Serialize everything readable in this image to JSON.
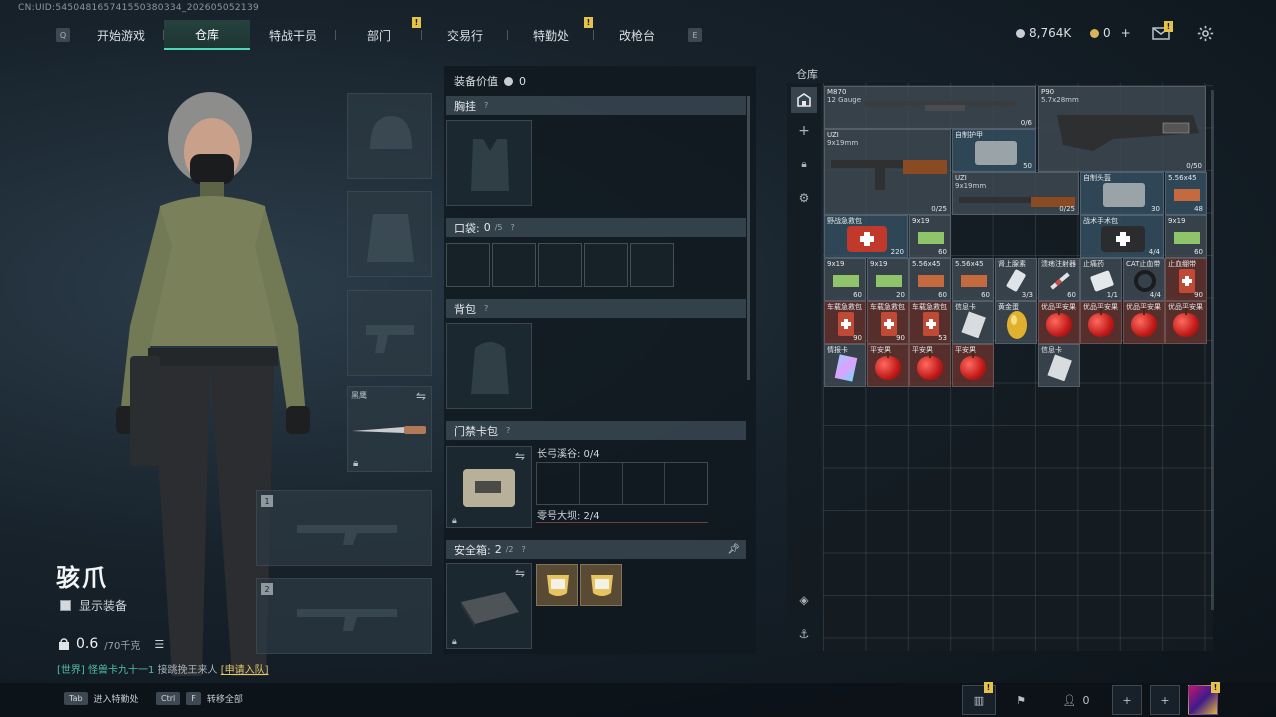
{
  "uid": "CN:UID:545048165741550380334_202605052139",
  "nav": {
    "left_key": "Q",
    "right_key": "E",
    "tabs": [
      {
        "label": "开始游戏",
        "active": false,
        "badge": ""
      },
      {
        "label": "仓库",
        "active": true,
        "badge": ""
      },
      {
        "label": "特战干员",
        "active": false,
        "badge": ""
      },
      {
        "label": "部门",
        "active": false,
        "badge": "!"
      },
      {
        "label": "交易行",
        "active": false,
        "badge": ""
      },
      {
        "label": "特勤处",
        "active": false,
        "badge": "!"
      },
      {
        "label": "改枪台",
        "active": false,
        "badge": ""
      }
    ]
  },
  "currency": {
    "silver": "8,764K",
    "gold": "0",
    "plus": "+",
    "mail_badge": "!"
  },
  "character": {
    "name": "骇爪",
    "show_equipment": "显示装备",
    "weight_value": "0.6",
    "weight_max": "/70千克"
  },
  "chat": {
    "channel": "[世界]",
    "sender": "怪兽卡九十一1",
    "message": "接跳挽王来人",
    "link": "[申请入队]"
  },
  "equipment": {
    "melee_label": "黑鹰",
    "weapon_slot_1": "1",
    "weapon_slot_2": "2"
  },
  "loadout": {
    "value_label": "装备价值",
    "value": "0",
    "chest_rig": "胸挂",
    "pocket_label": "口袋:",
    "pocket_value": "0",
    "pocket_max": "/5",
    "backpack": "背包",
    "keycard": "门禁卡包",
    "keycard_1": "长弓溪谷: 0/4",
    "keycard_2": "零号大坝: 2/4",
    "safe_box_label": "安全箱:",
    "safe_box_value": "2",
    "safe_box_max": "/2",
    "help": "?"
  },
  "warehouse": {
    "title": "仓库",
    "items": [
      {
        "name": "M870",
        "sub": "12 Gauge",
        "count": "0/6"
      },
      {
        "name": "P90",
        "sub": "5.7x28mm",
        "count": "0/50"
      },
      {
        "name": "UZI",
        "sub": "9x19mm",
        "count": "0/25"
      },
      {
        "name": "自制护甲",
        "sub": "",
        "count": "50"
      },
      {
        "name": "UZI",
        "sub": "9x19mm",
        "count": "0/25"
      },
      {
        "name": "自制头盔",
        "sub": "",
        "count": "30"
      },
      {
        "name": "5.56x45",
        "sub": "",
        "count": "48"
      },
      {
        "name": "野战急救包",
        "sub": "",
        "count": "220"
      },
      {
        "name": "9x19",
        "sub": "",
        "count": "60"
      },
      {
        "name": "战术手术包",
        "sub": "",
        "count": "4/4"
      },
      {
        "name": "9x19",
        "sub": "",
        "count": "60"
      },
      {
        "name": "9x19",
        "sub": "",
        "count": "60"
      },
      {
        "name": "9x19",
        "sub": "",
        "count": "20"
      },
      {
        "name": "5.56x45",
        "sub": "",
        "count": "60"
      },
      {
        "name": "5.56x45",
        "sub": "",
        "count": "60"
      },
      {
        "name": "肾上腺素",
        "sub": "",
        "count": "3/3"
      },
      {
        "name": "溃疡注射器",
        "sub": "",
        "count": "60"
      },
      {
        "name": "止痛药",
        "sub": "",
        "count": "1/1"
      },
      {
        "name": "CAT止血带",
        "sub": "",
        "count": "4/4"
      },
      {
        "name": "止血绷带",
        "sub": "",
        "count": "90"
      },
      {
        "name": "车载急救包",
        "sub": "",
        "count": "90"
      },
      {
        "name": "车载急救包",
        "sub": "",
        "count": "90"
      },
      {
        "name": "车载急救包",
        "sub": "",
        "count": "53"
      },
      {
        "name": "信息卡",
        "sub": "",
        "count": ""
      },
      {
        "name": "黄金蛋",
        "sub": "",
        "count": ""
      },
      {
        "name": "优品平安果",
        "sub": "",
        "count": ""
      },
      {
        "name": "优品平安果",
        "sub": "",
        "count": ""
      },
      {
        "name": "优品平安果",
        "sub": "",
        "count": ""
      },
      {
        "name": "优品平安果",
        "sub": "",
        "count": ""
      },
      {
        "name": "情报卡",
        "sub": "",
        "count": ""
      },
      {
        "name": "平安果",
        "sub": "",
        "count": ""
      },
      {
        "name": "平安果",
        "sub": "",
        "count": ""
      },
      {
        "name": "平安果",
        "sub": "",
        "count": ""
      },
      {
        "name": "信息卡",
        "sub": "",
        "count": ""
      }
    ]
  },
  "bottom": {
    "tab_key": "Tab",
    "tab_label": "进入特勤处",
    "ctrl_key": "Ctrl",
    "ctrl_k2": "F",
    "ctrl_label": "转移全部",
    "team_count": "0",
    "stats_badge": "!",
    "avatar_badge": "!"
  }
}
